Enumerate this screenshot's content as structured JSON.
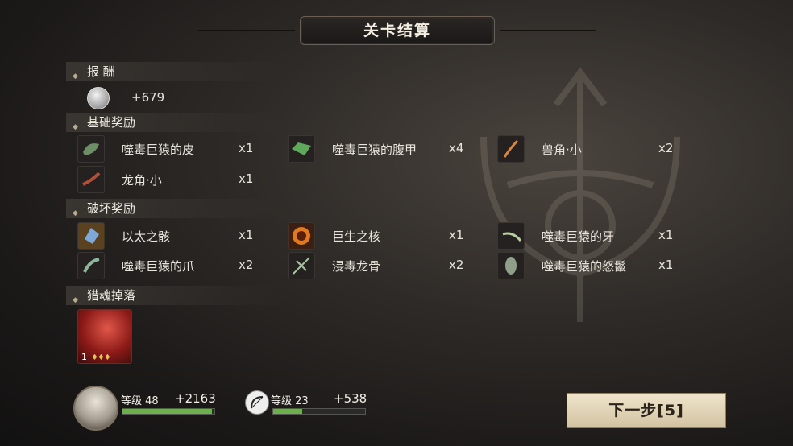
{
  "title": "关卡结算",
  "sections": {
    "reward": {
      "label": "报 酬",
      "value": "+679"
    },
    "basic": {
      "label": "基础奖励",
      "items": [
        {
          "name": "噬毒巨猿的皮",
          "qty": "x1",
          "icon": "green-hide-icon"
        },
        {
          "name": "噬毒巨猿的腹甲",
          "qty": "x4",
          "icon": "green-plate-icon"
        },
        {
          "name": "兽角·小",
          "qty": "x2",
          "icon": "beast-horn-icon"
        },
        {
          "name": "龙角·小",
          "qty": "x1",
          "icon": "dragon-horn-icon"
        }
      ]
    },
    "break": {
      "label": "破坏奖励",
      "items": [
        {
          "name": "以太之骸",
          "qty": "x1",
          "icon": "ether-crystal-icon"
        },
        {
          "name": "巨生之核",
          "qty": "x1",
          "icon": "giant-core-icon"
        },
        {
          "name": "噬毒巨猿的牙",
          "qty": "x1",
          "icon": "fang-icon"
        },
        {
          "name": "噬毒巨猿的爪",
          "qty": "x2",
          "icon": "claw-icon"
        },
        {
          "name": "浸毒龙骨",
          "qty": "x2",
          "icon": "poison-bone-icon"
        },
        {
          "name": "噬毒巨猿的怒鬣",
          "qty": "x1",
          "icon": "mane-icon"
        }
      ]
    },
    "soul": {
      "label": "猎魂掉落",
      "card_level": "1",
      "card_stars": "♦♦♦"
    }
  },
  "footer": {
    "player": {
      "label": "等级 48",
      "gain": "+2163",
      "progress": 0.97
    },
    "weapon": {
      "label": "等级 23",
      "gain": "+538",
      "progress": 0.32
    },
    "next_button": "下一步[5]"
  },
  "colors": {
    "bar_fill": "#6fae4f",
    "button_bg": "#e6dac0"
  }
}
